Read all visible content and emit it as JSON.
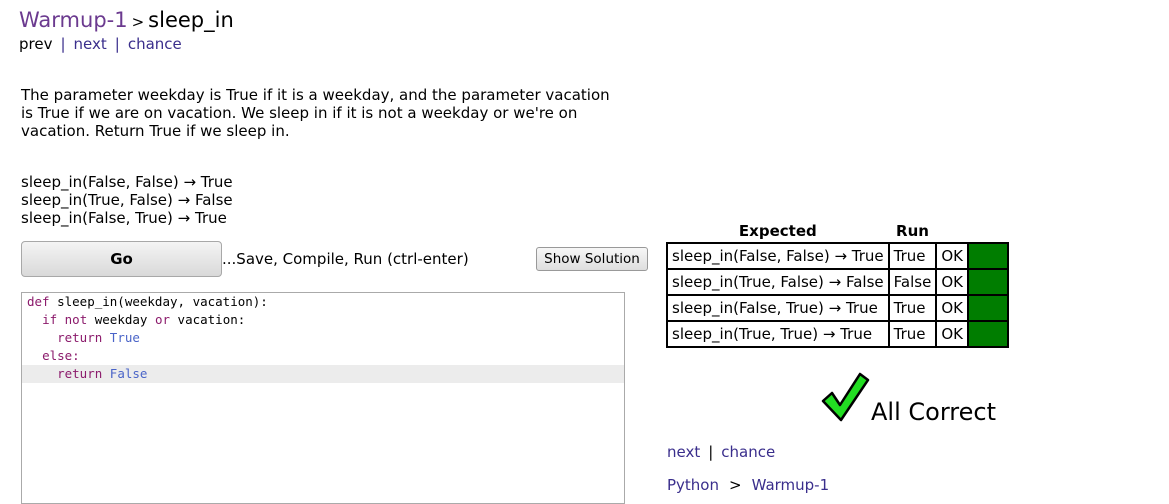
{
  "breadcrumb": {
    "section": "Warmup-1",
    "separator": ">",
    "problem": "sleep_in"
  },
  "nav": {
    "prev": "prev",
    "next": "next",
    "chance": "chance",
    "bar": "|"
  },
  "description": "The parameter weekday is True if it is a weekday, and the parameter vacation is True if we are on vacation. We sleep in if it is not a weekday or we're on vacation. Return True if we sleep in.",
  "examples": [
    "sleep_in(False, False) → True",
    "sleep_in(True, False) → False",
    "sleep_in(False, True) → True"
  ],
  "go_button": "Go",
  "go_hint": "...Save, Compile, Run (ctrl-enter)",
  "show_solution_button": "Show Solution",
  "code": {
    "l1_def": "def",
    "l1_rest": " sleep_in(weekday, vacation):",
    "l2_if": "if",
    "l2_not": "not",
    "l2_weekday": " weekday ",
    "l2_or": "or",
    "l2_rest": " vacation:",
    "l3_return": "return",
    "l3_value": "True",
    "l4_else": "else:",
    "l5_return": "return",
    "l5_value": "False"
  },
  "results": {
    "header_expected": "Expected",
    "header_run": "Run",
    "rows": [
      {
        "expected": "sleep_in(False, False) → True",
        "run": "True",
        "ok": "OK",
        "status_color": "#007d00"
      },
      {
        "expected": "sleep_in(True, False) → False",
        "run": "False",
        "ok": "OK",
        "status_color": "#007d00"
      },
      {
        "expected": "sleep_in(False, True) → True",
        "run": "True",
        "ok": "OK",
        "status_color": "#007d00"
      },
      {
        "expected": "sleep_in(True, True) → True",
        "run": "True",
        "ok": "OK",
        "status_color": "#007d00"
      }
    ]
  },
  "all_correct": "All Correct",
  "check_icon": "checkmark-icon",
  "bottom_nav": {
    "next": "next",
    "chance": "chance",
    "bar": "|"
  },
  "bottom_breadcrumb": {
    "language": "Python",
    "separator": ">",
    "section": "Warmup-1"
  },
  "colors": {
    "link": "#3a2e8c",
    "section": "#6b3a8f",
    "ok_green": "#007d00",
    "check_green": "#22dd22",
    "keyword": "#8b1a6b",
    "constant": "#4a64c8"
  }
}
